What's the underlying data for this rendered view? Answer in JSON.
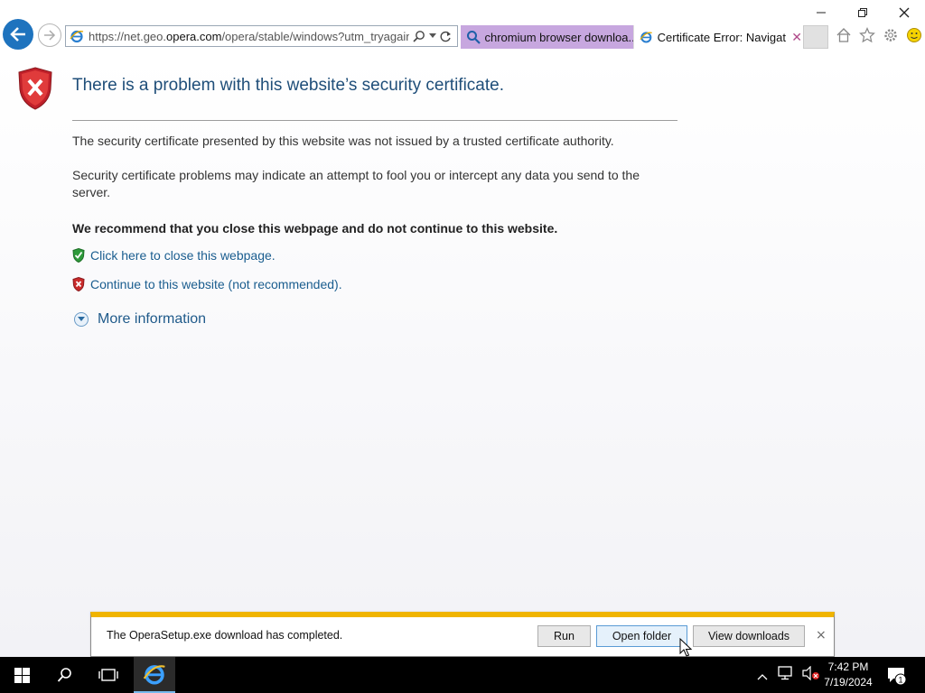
{
  "browser": {
    "url_prefix": "https://net.geo.",
    "url_domain": "opera.com",
    "url_suffix": "/opera/stable/windows?utm_tryagain=ye",
    "tabs": [
      {
        "label": "chromium browser downloa...",
        "icon": "search-icon"
      },
      {
        "label": "Certificate Error: Navigati...",
        "icon": "ie-icon",
        "active": true
      }
    ]
  },
  "page": {
    "title": "There is a problem with this website’s security certificate.",
    "para1": "The security certificate presented by this website was not issued by a trusted certificate authority.",
    "para2": "Security certificate problems may indicate an attempt to fool you or intercept any data you send to the server.",
    "recommendation": "We recommend that you close this webpage and do not continue to this website.",
    "close_link": "Click here to close this webpage.",
    "continue_link": "Continue to this website (not recommended).",
    "more_info": "More information"
  },
  "download_bar": {
    "message": "The OperaSetup.exe download has completed.",
    "run_label": "Run",
    "open_folder_label": "Open folder",
    "view_downloads_label": "View downloads",
    "close_glyph": "×",
    "accent_color": "#f0b400"
  },
  "taskbar": {
    "time": "7:42 PM",
    "date": "7/19/2024",
    "notification_count": "1"
  },
  "colors": {
    "title": "#1f4e79",
    "link": "#1a5d8f",
    "back_button": "#1e73be",
    "search_tab": "#c7a7df"
  }
}
